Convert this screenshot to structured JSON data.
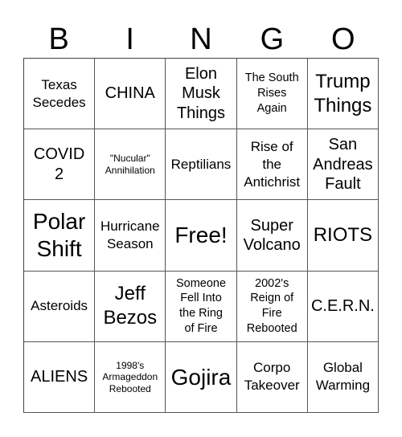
{
  "header": {
    "letters": [
      "B",
      "I",
      "N",
      "G",
      "O"
    ]
  },
  "cells": [
    {
      "text": "Texas\nSecedes"
    },
    {
      "text": "CHINA"
    },
    {
      "text": "Elon\nMusk\nThings"
    },
    {
      "text": "The South\nRises\nAgain"
    },
    {
      "text": "Trump\nThings"
    },
    {
      "text": "COVID\n2"
    },
    {
      "text": "\"Nucular\"\nAnnihilation"
    },
    {
      "text": "Reptilians"
    },
    {
      "text": "Rise of\nthe\nAntichrist"
    },
    {
      "text": "San\nAndreas\nFault"
    },
    {
      "text": "Polar\nShift"
    },
    {
      "text": "Hurricane\nSeason"
    },
    {
      "text": "Free!"
    },
    {
      "text": "Super\nVolcano"
    },
    {
      "text": "RIOTS"
    },
    {
      "text": "Asteroids"
    },
    {
      "text": "Jeff\nBezos"
    },
    {
      "text": "Someone\nFell Into\nthe Ring\nof Fire"
    },
    {
      "text": "2002's\nReign of\nFire\nRebooted"
    },
    {
      "text": "C.E.R.N."
    },
    {
      "text": "ALIENS"
    },
    {
      "text": "1998's\nArmageddon\nRebooted"
    },
    {
      "text": "Gojira"
    },
    {
      "text": "Corpo\nTakeover"
    },
    {
      "text": "Global\nWarming"
    }
  ]
}
